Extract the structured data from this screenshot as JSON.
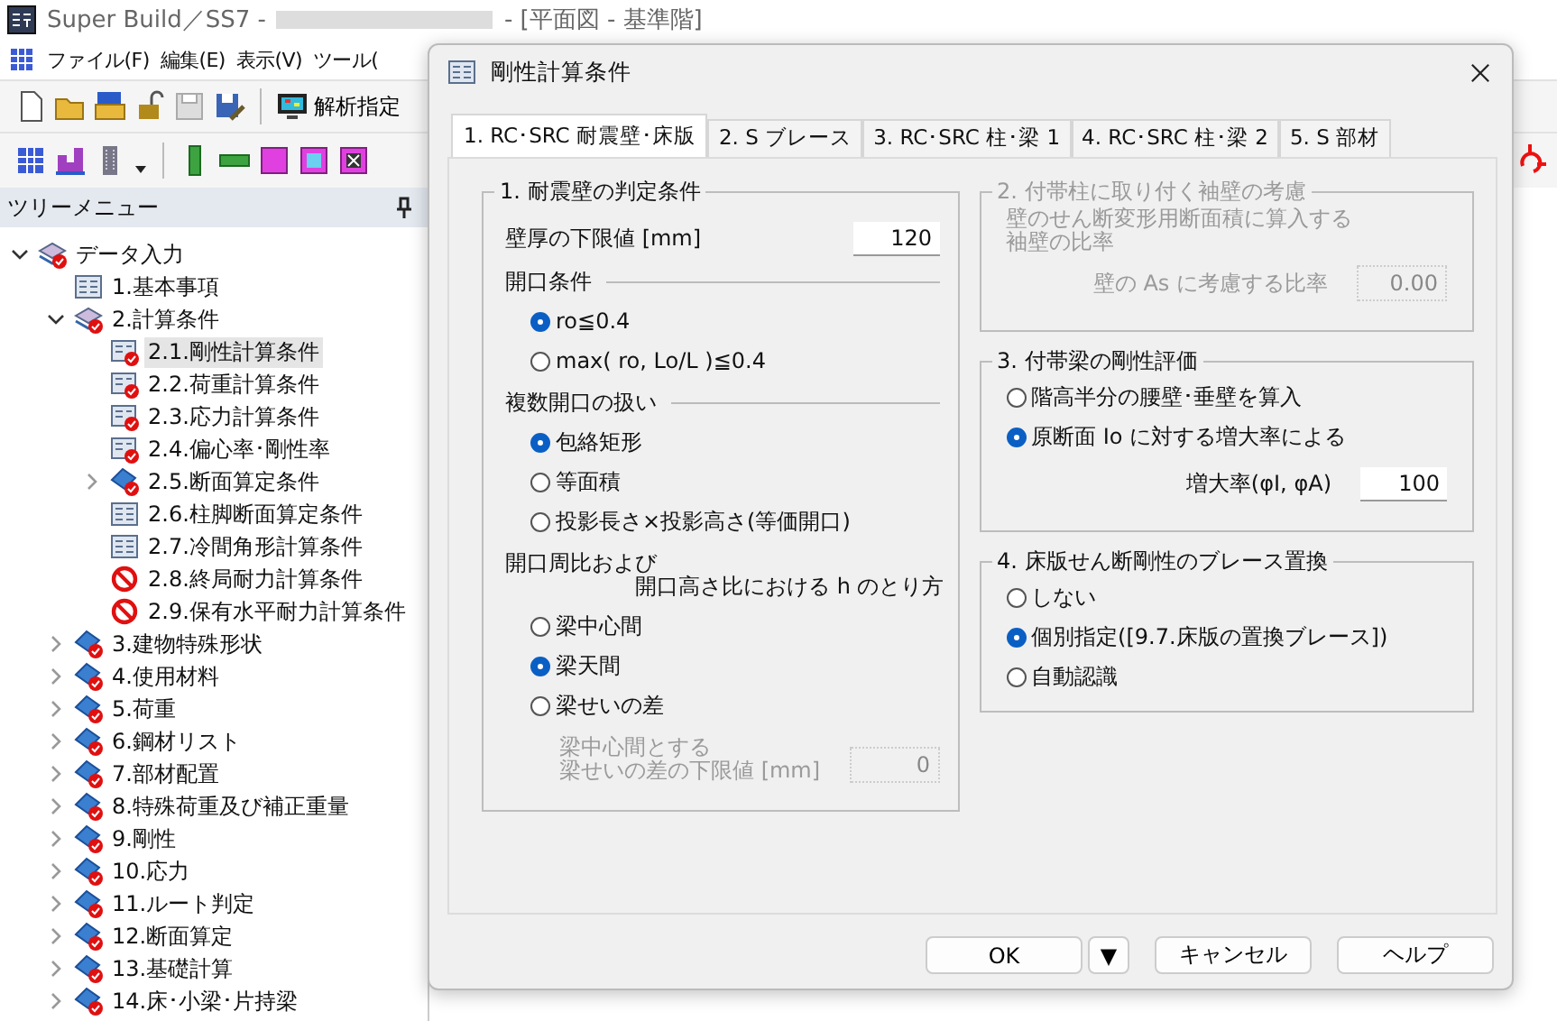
{
  "window": {
    "title_start": "Super Build／SS7 -",
    "title_end": "- [平面図 - 基準階]"
  },
  "menu": [
    "ファイル(F)",
    "編集(E)",
    "表示(V)",
    "ツール("
  ],
  "toolbar": {
    "analysis_button": "解析指定"
  },
  "tree_panel": {
    "title": "ツリーメニュー",
    "items": [
      {
        "label": "データ入力",
        "kind": "stack",
        "expanded": true,
        "selected": false,
        "children": [
          {
            "label": "1.基本事項",
            "kind": "form",
            "selected": false
          },
          {
            "label": "2.計算条件",
            "kind": "stack",
            "expanded": true,
            "selected": false,
            "children": [
              {
                "label": "2.1.剛性計算条件",
                "kind": "form-check",
                "selected": true
              },
              {
                "label": "2.2.荷重計算条件",
                "kind": "form-check",
                "selected": false
              },
              {
                "label": "2.3.応力計算条件",
                "kind": "form-check",
                "selected": false
              },
              {
                "label": "2.4.偏心率･剛性率",
                "kind": "form-check",
                "selected": false
              },
              {
                "label": "2.5.断面算定条件",
                "kind": "book",
                "expanded": false,
                "selected": false
              },
              {
                "label": "2.6.柱脚断面算定条件",
                "kind": "form",
                "selected": false
              },
              {
                "label": "2.7.冷間角形計算条件",
                "kind": "form",
                "selected": false
              },
              {
                "label": "2.8.終局耐力計算条件",
                "kind": "prohibited",
                "selected": false
              },
              {
                "label": "2.9.保有水平耐力計算条件",
                "kind": "prohibited",
                "selected": false
              }
            ]
          },
          {
            "label": "3.建物特殊形状",
            "kind": "book",
            "expanded": false,
            "selected": false
          },
          {
            "label": "4.使用材料",
            "kind": "book",
            "expanded": false,
            "selected": false
          },
          {
            "label": "5.荷重",
            "kind": "book",
            "expanded": false,
            "selected": false
          },
          {
            "label": "6.鋼材リスト",
            "kind": "book",
            "expanded": false,
            "selected": false
          },
          {
            "label": "7.部材配置",
            "kind": "book",
            "expanded": false,
            "selected": false
          },
          {
            "label": "8.特殊荷重及び補正重量",
            "kind": "book",
            "expanded": false,
            "selected": false
          },
          {
            "label": "9.剛性",
            "kind": "book",
            "expanded": false,
            "selected": false
          },
          {
            "label": "10.応力",
            "kind": "book",
            "expanded": false,
            "selected": false
          },
          {
            "label": "11.ルート判定",
            "kind": "book",
            "expanded": false,
            "selected": false
          },
          {
            "label": "12.断面算定",
            "kind": "book",
            "expanded": false,
            "selected": false
          },
          {
            "label": "13.基礎計算",
            "kind": "book",
            "expanded": false,
            "selected": false
          },
          {
            "label": "14.床･小梁･片持梁",
            "kind": "book",
            "expanded": false,
            "selected": false
          }
        ]
      }
    ]
  },
  "dialog": {
    "title": "剛性計算条件",
    "tabs": [
      {
        "label": "1. RC･SRC 耐震壁･床版",
        "selected": true
      },
      {
        "label": "2. S ブレース",
        "selected": false
      },
      {
        "label": "3. RC･SRC 柱･梁 1",
        "selected": false
      },
      {
        "label": "4. RC･SRC 柱･梁 2",
        "selected": false
      },
      {
        "label": "5. S 部材",
        "selected": false
      }
    ],
    "group1": {
      "title": "1. 耐震壁の判定条件",
      "thickness_label": "壁厚の下限値 [mm]",
      "thickness_value": "120",
      "sections": [
        {
          "heading": [
            "開口条件"
          ],
          "options": [
            {
              "label": "ro≦0.4",
              "selected": true
            },
            {
              "label": "max( ro, Lo/L )≦0.4",
              "selected": false
            }
          ]
        },
        {
          "heading": [
            "複数開口の扱い"
          ],
          "options": [
            {
              "label": "包絡矩形",
              "selected": true
            },
            {
              "label": "等面積",
              "selected": false
            },
            {
              "label": "投影長さ×投影高さ(等価開口)",
              "selected": false
            }
          ]
        },
        {
          "heading": [
            "開口周比および",
            "開口高さ比における h のとり方"
          ],
          "options": [
            {
              "label": "梁中心間",
              "selected": false
            },
            {
              "label": "梁天間",
              "selected": true
            },
            {
              "label": "梁せいの差",
              "selected": false
            }
          ]
        }
      ],
      "sub_field": {
        "label": [
          "梁中心間とする",
          "梁せいの差の下限値 [mm]"
        ],
        "value": "0",
        "disabled": true
      }
    },
    "group2": {
      "title": "2. 付帯柱に取り付く袖壁の考慮",
      "disabled": true,
      "description": [
        "壁のせん断変形用断面積に算入する",
        "袖壁の比率"
      ],
      "field_label": "壁の As に考慮する比率",
      "field_value": "0.00"
    },
    "group3": {
      "title": "3. 付帯梁の剛性評価",
      "options": [
        {
          "label": "階高半分の腰壁･垂壁を算入",
          "selected": false
        },
        {
          "label": "原断面 Io に対する増大率による",
          "selected": true
        }
      ],
      "field_label": "増大率(φI, φA)",
      "field_value": "100"
    },
    "group4": {
      "title": "4. 床版せん断剛性のブレース置換",
      "options": [
        {
          "label": "しない",
          "selected": false
        },
        {
          "label": "個別指定([9.7.床版の置換ブレース])",
          "selected": true
        },
        {
          "label": "自動認識",
          "selected": false
        }
      ]
    },
    "buttons": {
      "ok": "OK",
      "dropdown": "▼",
      "cancel": "キャンセル",
      "help": "ヘルプ"
    }
  }
}
